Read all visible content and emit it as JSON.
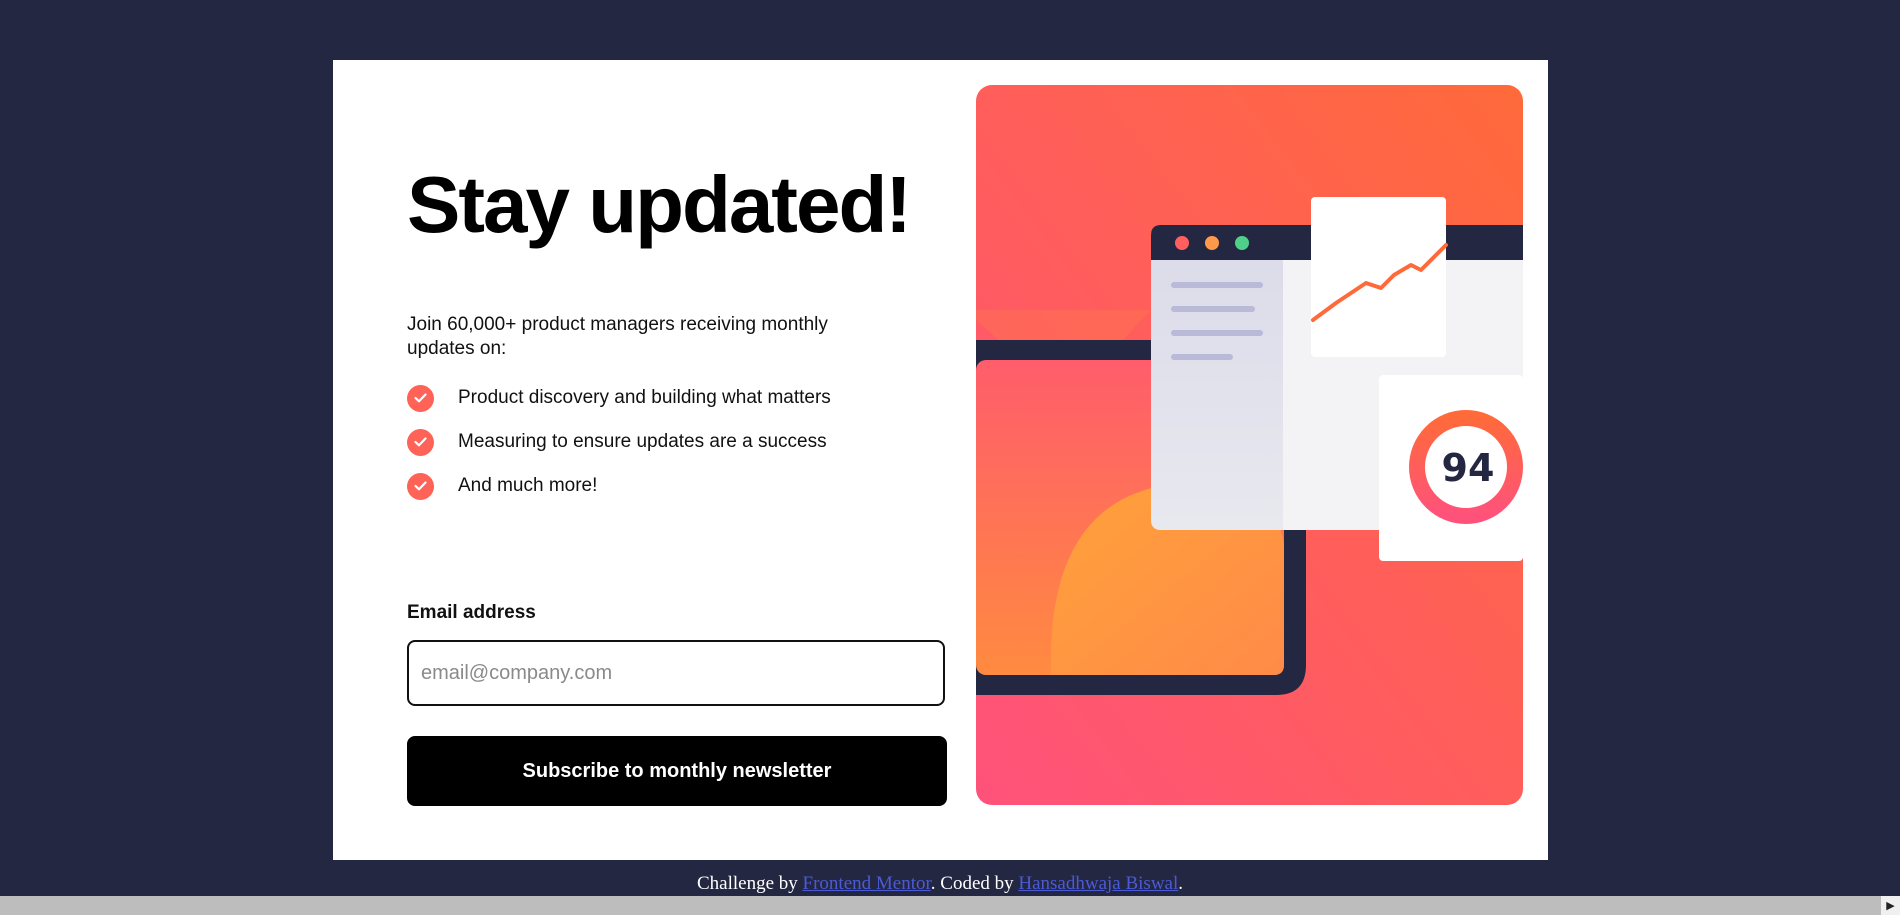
{
  "signup": {
    "title": "Stay updated!",
    "intro": "Join 60,000+ product managers receiving monthly updates on:",
    "features": [
      "Product discovery and building what matters",
      "Measuring to ensure updates are a success",
      "And much more!"
    ],
    "email_label": "Email address",
    "email_placeholder": "email@company.com",
    "email_value": "",
    "subscribe_label": "Subscribe to monthly newsletter"
  },
  "illustration": {
    "score": "94",
    "icon": "dashboard-illustration"
  },
  "footer": {
    "prefix": "Challenge by ",
    "link1": "Frontend Mentor",
    "middle": ". Coded by ",
    "link2": "Hansadhwaja Biswal",
    "suffix": "."
  },
  "colors": {
    "background": "#242742",
    "accent": "#ff6257",
    "button": "#000000"
  }
}
